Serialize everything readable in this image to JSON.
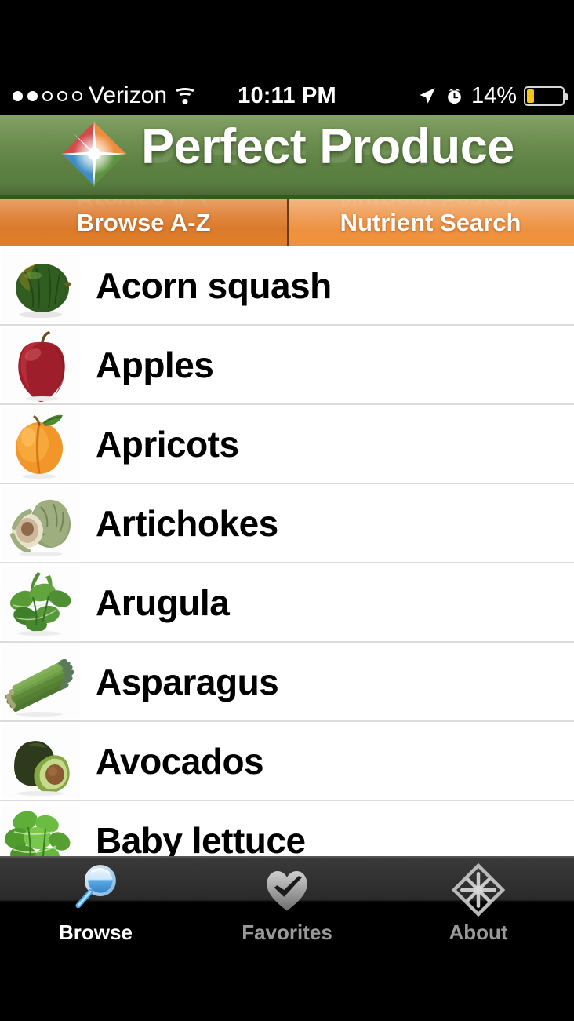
{
  "status_bar": {
    "signal_dots_filled": 2,
    "signal_dots_total": 5,
    "carrier": "Verizon",
    "wifi_icon": "wifi-icon",
    "time": "10:11 PM",
    "location_icon": "location-arrow-icon",
    "alarm_icon": "alarm-clock-icon",
    "battery_percent": "14%",
    "battery_fill_color": "#f5c518"
  },
  "header": {
    "title": "Perfect Produce",
    "logo_icon": "perfect-produce-diamond-logo",
    "background_color": "#5d8243"
  },
  "segmented_tabs": {
    "selected_index": 0,
    "items": [
      {
        "label": "Browse A-Z",
        "selected": true
      },
      {
        "label": "Nutrient Search",
        "selected": false
      }
    ],
    "selected_color": "#dc7a2c",
    "unselected_color": "#ee913f"
  },
  "produce_list": [
    {
      "name": "Acorn squash",
      "image": "acorn-squash-photo"
    },
    {
      "name": "Apples",
      "image": "apple-photo"
    },
    {
      "name": "Apricots",
      "image": "apricot-photo"
    },
    {
      "name": "Artichokes",
      "image": "artichoke-photo"
    },
    {
      "name": "Arugula",
      "image": "arugula-photo"
    },
    {
      "name": "Asparagus",
      "image": "asparagus-photo"
    },
    {
      "name": "Avocados",
      "image": "avocado-photo"
    },
    {
      "name": "Baby lettuce",
      "image": "baby-lettuce-photo"
    }
  ],
  "bottom_tab_bar": {
    "active_index": 0,
    "items": [
      {
        "label": "Browse",
        "icon": "magnifying-glass-icon",
        "active": true
      },
      {
        "label": "Favorites",
        "icon": "heart-check-icon",
        "active": false
      },
      {
        "label": "About",
        "icon": "diamond-starburst-icon",
        "active": false
      }
    ],
    "active_label_color": "#ffffff",
    "inactive_label_color": "#9a9a9a"
  }
}
